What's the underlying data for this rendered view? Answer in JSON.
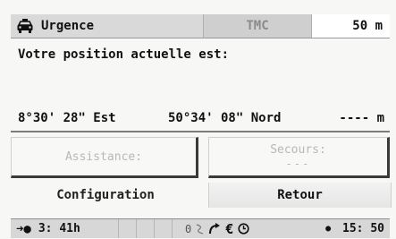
{
  "header": {
    "title": "Urgence",
    "mode": "TMC",
    "distance": "50 m"
  },
  "message": "Votre position actuelle est:",
  "position": {
    "longitude": "8°30' 28\" Est",
    "latitude": "50°34' 08\" Nord",
    "altitude": "---- m"
  },
  "buttons": {
    "assistance": "Assistance:",
    "secours": "Secours:",
    "secours_value": "---",
    "configuration": "Configuration",
    "retour": "Retour"
  },
  "status": {
    "remaining_time": "3: 41h",
    "tmc_count": "0",
    "clock": "15: 50"
  },
  "icons": {
    "header": "emergency-car-icon",
    "nav": "arrow-right-icon",
    "status": [
      "tmc-signal-icon",
      "route-icon",
      "euro-icon",
      "clock-icon",
      "dot-icon"
    ]
  }
}
